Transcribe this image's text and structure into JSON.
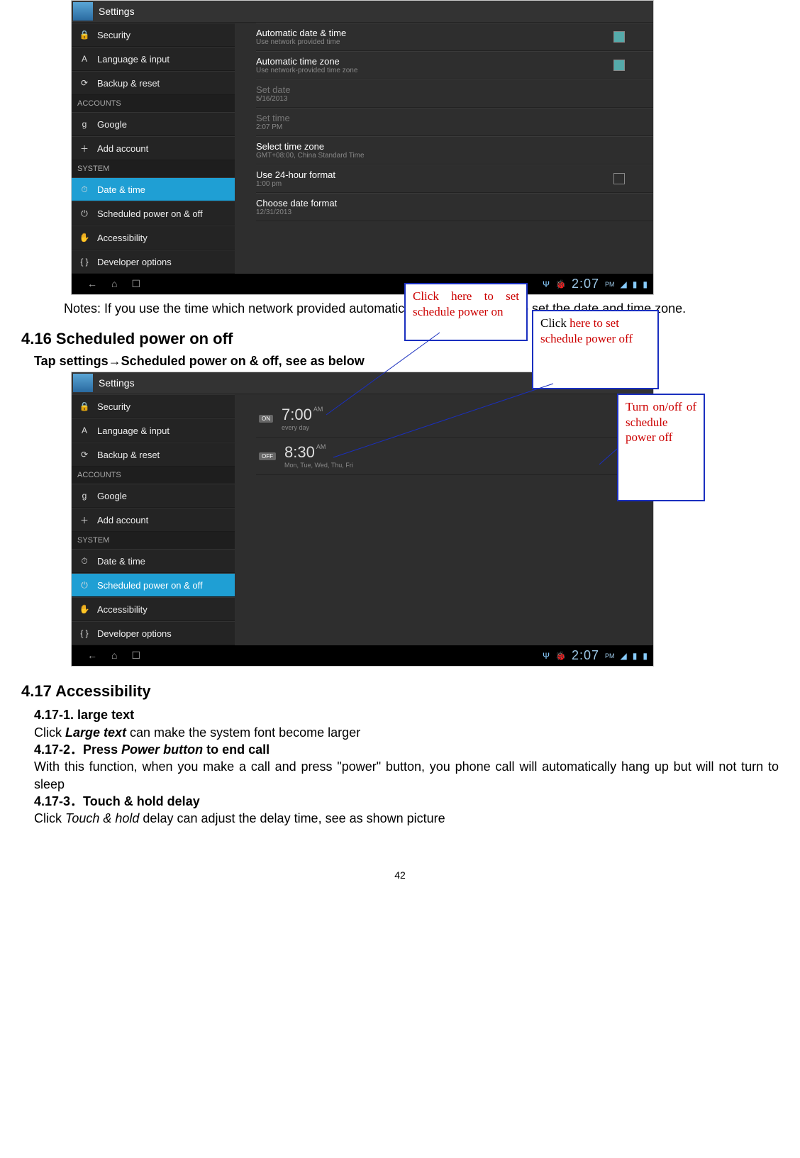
{
  "screenshot1": {
    "app_title": "Settings",
    "sidebar": [
      {
        "type": "item",
        "icon": "lock",
        "label": "Security"
      },
      {
        "type": "item",
        "icon": "A",
        "label": "Language & input"
      },
      {
        "type": "item",
        "icon": "loop",
        "label": "Backup & reset"
      },
      {
        "type": "header",
        "label": "ACCOUNTS"
      },
      {
        "type": "item",
        "icon": "g",
        "label": "Google"
      },
      {
        "type": "item",
        "icon": "plus",
        "label": "Add account"
      },
      {
        "type": "header",
        "label": "SYSTEM"
      },
      {
        "type": "item",
        "icon": "clock",
        "label": "Date & time",
        "selected": true
      },
      {
        "type": "item",
        "icon": "power",
        "label": "Scheduled power on & off"
      },
      {
        "type": "item",
        "icon": "hand",
        "label": "Accessibility"
      },
      {
        "type": "item",
        "icon": "braces",
        "label": "Developer options"
      }
    ],
    "details": [
      {
        "title": "Automatic date & time",
        "sub": "Use network provided time",
        "check": "checked"
      },
      {
        "title": "Automatic time zone",
        "sub": "Use network-provided time zone",
        "check": "checked"
      },
      {
        "title": "Set date",
        "sub": "5/16/2013",
        "disabled": true
      },
      {
        "title": "Set time",
        "sub": "2:07 PM",
        "disabled": true
      },
      {
        "title": "Select time zone",
        "sub": "GMT+08:00, China Standard Time"
      },
      {
        "title": "Use 24-hour format",
        "sub": "1:00 pm",
        "check": "unchecked"
      },
      {
        "title": "Choose date format",
        "sub": "12/31/2013"
      }
    ],
    "status_time": "2:07",
    "status_ampm": "PM"
  },
  "notes_text": "Notes: If you use the time which network provided automatically, you are unable to set the date and time zone.",
  "section_416": "4.16 Scheduled power on off",
  "lead_416": "Tap settings→Scheduled power on & off, see as below",
  "screenshot2": {
    "app_title": "Settings",
    "sidebar": [
      {
        "type": "item",
        "icon": "lock",
        "label": "Security"
      },
      {
        "type": "item",
        "icon": "A",
        "label": "Language & input"
      },
      {
        "type": "item",
        "icon": "loop",
        "label": "Backup & reset"
      },
      {
        "type": "header",
        "label": "ACCOUNTS"
      },
      {
        "type": "item",
        "icon": "g",
        "label": "Google"
      },
      {
        "type": "item",
        "icon": "plus",
        "label": "Add account"
      },
      {
        "type": "header",
        "label": "SYSTEM"
      },
      {
        "type": "item",
        "icon": "clock",
        "label": "Date & time"
      },
      {
        "type": "item",
        "icon": "power",
        "label": "Scheduled power on & off",
        "selected": true
      },
      {
        "type": "item",
        "icon": "hand",
        "label": "Accessibility"
      },
      {
        "type": "item",
        "icon": "braces",
        "label": "Developer options"
      }
    ],
    "schedule": [
      {
        "badge": "ON",
        "time": "7:00",
        "ampm": "AM",
        "days": "every day",
        "checked": true
      },
      {
        "badge": "OFF",
        "time": "8:30",
        "ampm": "AM",
        "days": "Mon, Tue, Wed, Thu, Fri",
        "checked": false
      }
    ],
    "status_time": "2:07",
    "status_ampm": "PM"
  },
  "callout1": "Click here to set schedule power on",
  "callout2": "Click here to set schedule power off",
  "callout3": "Turn on/off of schedule power off",
  "section_417": "4.17 Accessibility",
  "h_4171": "4.17-1. large text",
  "p_4171a": "Click ",
  "p_4171b": "Large text",
  "p_4171c": " can make the system font become larger",
  "h_4172": "4.17-2．Press ",
  "h_4172b": "Power button",
  "h_4172c": " to end call",
  "p_4172": "With this function, when you make a call and press \"power\" button, you phone call will automatically hang up but will not turn to sleep",
  "h_4173": "4.17-3．Touch & hold delay",
  "p_4173a": "Click ",
  "p_4173b": "Touch & hold",
  "p_4173c": " delay can adjust the delay time, see as shown picture",
  "page_num": "42"
}
